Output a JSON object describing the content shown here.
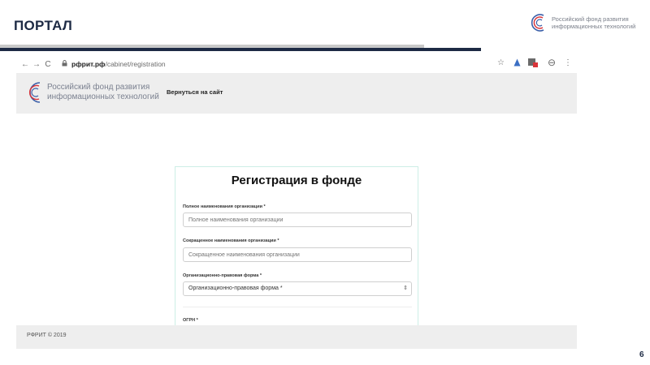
{
  "slide": {
    "title": "ПОРТАЛ",
    "page_number": "6"
  },
  "top_logo": {
    "line1": "Российский фонд развития",
    "line2": "информационных технологий"
  },
  "browser": {
    "url_domain": "рфрит.рф",
    "url_path": "/cabinet/registration",
    "back_icon": "←",
    "forward_icon": "→",
    "reload_icon": "C",
    "lock_icon": "🔒",
    "star_icon": "☆",
    "profile_icon": "⊖",
    "menu_icon": "⋮"
  },
  "site": {
    "logo_line1": "Российский фонд развития",
    "logo_line2": "информационных технологий",
    "back_link": "Вернуться на сайт",
    "footer_copyright": "РФРИТ © 2019"
  },
  "form": {
    "title": "Регистрация в фонде",
    "full_name": {
      "label": "Полное наименования организации *",
      "placeholder": "Полное наименования организации"
    },
    "short_name": {
      "label": "Сокращенное наименования организации *",
      "placeholder": "Сокращенное наименования организации"
    },
    "legal_form": {
      "label": "Организационно-правовая форма *",
      "selected": "Организационно-правовая форма *",
      "arrow": "⇕"
    },
    "ogrn": {
      "label": "ОГРН *"
    }
  },
  "colors": {
    "navy": "#1d2a44",
    "card_border": "#cdeee6",
    "logo_blue": "#3b5fa8",
    "logo_red": "#d9343a"
  }
}
